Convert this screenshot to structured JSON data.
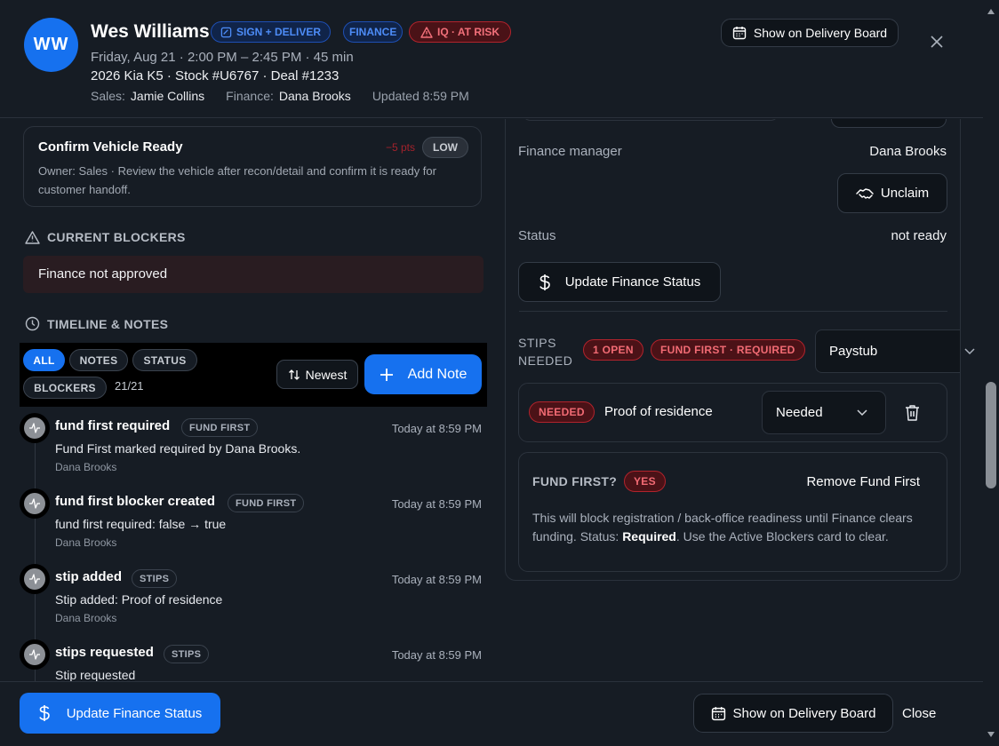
{
  "header": {
    "avatar_initials": "WW",
    "customer_name": "Wes Williams",
    "badges": {
      "sign_deliver": "SIGN + DELIVER",
      "finance": "FINANCE",
      "iq": "IQ · AT RISK"
    },
    "schedule": "Friday, Aug 21 · 2:00 PM – 2:45 PM · 45 min",
    "vehicle": "2026 Kia K5 · Stock #U6767 · Deal #1233",
    "sales_label": "Sales:",
    "sales_name": "Jamie Collins",
    "finance_label": "Finance:",
    "finance_name": "Dana Brooks",
    "updated": "Updated 8:59 PM",
    "delivery_board_button": "Show on Delivery Board"
  },
  "task": {
    "title": "Confirm Vehicle Ready",
    "points": "−5 pts",
    "priority": "LOW",
    "description": "Owner: Sales · Review the vehicle after recon/detail and confirm it is ready for customer handoff."
  },
  "blockers": {
    "heading": "CURRENT BLOCKERS",
    "items": [
      "Finance not approved"
    ]
  },
  "timeline": {
    "heading": "TIMELINE & NOTES",
    "filters": {
      "all": "ALL",
      "notes": "NOTES",
      "status": "STATUS",
      "blockers": "BLOCKERS"
    },
    "count": "21/21",
    "sort_button": "Newest",
    "add_note_button": "Add Note",
    "items": [
      {
        "title": "fund first required",
        "tag": "FUND FIRST",
        "time": "Today at 8:59 PM",
        "body": "Fund First marked required by Dana Brooks.",
        "by": "Dana Brooks"
      },
      {
        "title": "fund first blocker created",
        "tag": "FUND FIRST",
        "time": "Today at 8:59 PM",
        "body": "fund first required: false → true",
        "by": "Dana Brooks"
      },
      {
        "title": "stip added",
        "tag": "STIPS",
        "time": "Today at 8:59 PM",
        "body": "Stip added: Proof of residence",
        "by": "Dana Brooks"
      },
      {
        "title": "stips requested",
        "tag": "STIPS",
        "time": "Today at 8:59 PM",
        "body": "Stip requested",
        "by": ""
      }
    ]
  },
  "finance_panel": {
    "manager_label": "Finance manager",
    "manager_value": "Dana Brooks",
    "unclaim_button": "Unclaim",
    "status_label": "Status",
    "status_value": "not ready",
    "update_status_button": "Update Finance Status",
    "stips_label_line1": "STIPS",
    "stips_label_line2": "NEEDED",
    "open_badge": "1 OPEN",
    "fund_first_badge": "FUND FIRST · REQUIRED",
    "stip_select_value": "Paystub",
    "stip_row": {
      "badge": "NEEDED",
      "name": "Proof of residence",
      "select_value": "Needed"
    },
    "fund_first": {
      "label": "FUND FIRST?",
      "badge": "YES",
      "remove_button": "Remove Fund First",
      "desc_prefix": "This will block registration / back-office readiness until Finance clears funding. Status: ",
      "desc_status": "Required",
      "desc_suffix": ". Use the Active Blockers card to clear."
    }
  },
  "footer": {
    "update_status_button": "Update Finance Status",
    "delivery_board_button": "Show on Delivery Board",
    "close_button": "Close"
  },
  "colors": {
    "accent_blue": "#1671ef",
    "danger_red": "#b2232c",
    "background": "#161c24"
  },
  "icons": [
    "calendar-icon",
    "close-icon",
    "alert-triangle-icon",
    "clock-icon",
    "sort-icon",
    "plus-icon",
    "activity-icon",
    "dollar-icon",
    "handshake-icon",
    "chevron-down-icon",
    "trash-icon",
    "sign-icon"
  ]
}
